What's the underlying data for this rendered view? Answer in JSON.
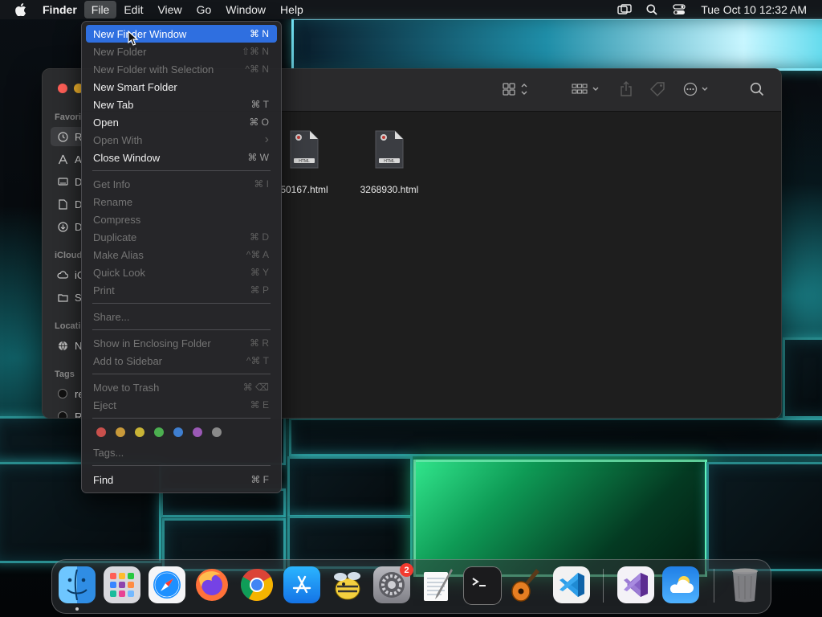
{
  "menubar": {
    "app_name": "Finder",
    "menus": [
      "File",
      "Edit",
      "View",
      "Go",
      "Window",
      "Help"
    ],
    "active_menu": "File",
    "clock": "Tue Oct 10  12:32 AM",
    "status_icons": [
      "screen-mirroring-icon",
      "spotlight-search-icon",
      "control-center-icon"
    ]
  },
  "file_menu": {
    "items": [
      {
        "label": "New Finder Window",
        "shortcut": "⌘ N",
        "enabled": true,
        "highlighted": true
      },
      {
        "label": "New Folder",
        "shortcut": "⇧⌘ N",
        "enabled": false
      },
      {
        "label": "New Folder with Selection",
        "shortcut": "^⌘ N",
        "enabled": false
      },
      {
        "label": "New Smart Folder",
        "shortcut": "",
        "enabled": true
      },
      {
        "label": "New Tab",
        "shortcut": "⌘ T",
        "enabled": true
      },
      {
        "label": "Open",
        "shortcut": "⌘ O",
        "enabled": true
      },
      {
        "label": "Open With",
        "shortcut": "›",
        "enabled": false
      },
      {
        "label": "Close Window",
        "shortcut": "⌘ W",
        "enabled": true
      },
      {
        "label": "Get Info",
        "shortcut": "⌘ I",
        "enabled": false
      },
      {
        "label": "Rename",
        "shortcut": "",
        "enabled": false
      },
      {
        "label": "Compress",
        "shortcut": "",
        "enabled": false
      },
      {
        "label": "Duplicate",
        "shortcut": "⌘ D",
        "enabled": false
      },
      {
        "label": "Make Alias",
        "shortcut": "^⌘ A",
        "enabled": false
      },
      {
        "label": "Quick Look",
        "shortcut": "⌘ Y",
        "enabled": false
      },
      {
        "label": "Print",
        "shortcut": "⌘ P",
        "enabled": false
      },
      {
        "label": "Share...",
        "shortcut": "",
        "enabled": false
      },
      {
        "label": "Show in Enclosing Folder",
        "shortcut": "⌘ R",
        "enabled": false
      },
      {
        "label": "Add to Sidebar",
        "shortcut": "^⌘ T",
        "enabled": false
      },
      {
        "label": "Move to Trash",
        "shortcut": "⌘ ⌫",
        "enabled": false
      },
      {
        "label": "Eject",
        "shortcut": "⌘ E",
        "enabled": false
      },
      {
        "label": "Tags...",
        "shortcut": "",
        "enabled": false
      },
      {
        "label": "Find",
        "shortcut": "⌘ F",
        "enabled": true
      }
    ],
    "tag_colors": [
      "#c9504c",
      "#c99a3a",
      "#c9b436",
      "#4caf50",
      "#3f7fd0",
      "#9b59b6",
      "#8a8a8a"
    ]
  },
  "finder": {
    "sidebar": {
      "sections": [
        "Favori",
        "iCloud",
        "Locati",
        "Tags"
      ],
      "items": [
        "R",
        "A",
        "D",
        "D",
        "D",
        "iC",
        "S",
        "N",
        "re",
        "R"
      ]
    },
    "toolbar_icons": [
      "icon-view-icon",
      "group-icon",
      "share-icon",
      "tag-icon",
      "more-icon",
      "search-icon"
    ],
    "files": [
      {
        "name": "50167.html",
        "type": "HTML"
      },
      {
        "name": "3268930.html",
        "type": "HTML"
      }
    ]
  },
  "dock": {
    "apps": [
      "Finder",
      "Launchpad",
      "Safari",
      "Firefox",
      "Chrome",
      "App Store",
      "Cyberduck",
      "System Settings",
      "TextEdit",
      "Terminal",
      "GarageBand",
      "Visual Studio Code",
      "Visual Studio",
      "Weather",
      "Trash"
    ],
    "settings_badge": "2"
  }
}
